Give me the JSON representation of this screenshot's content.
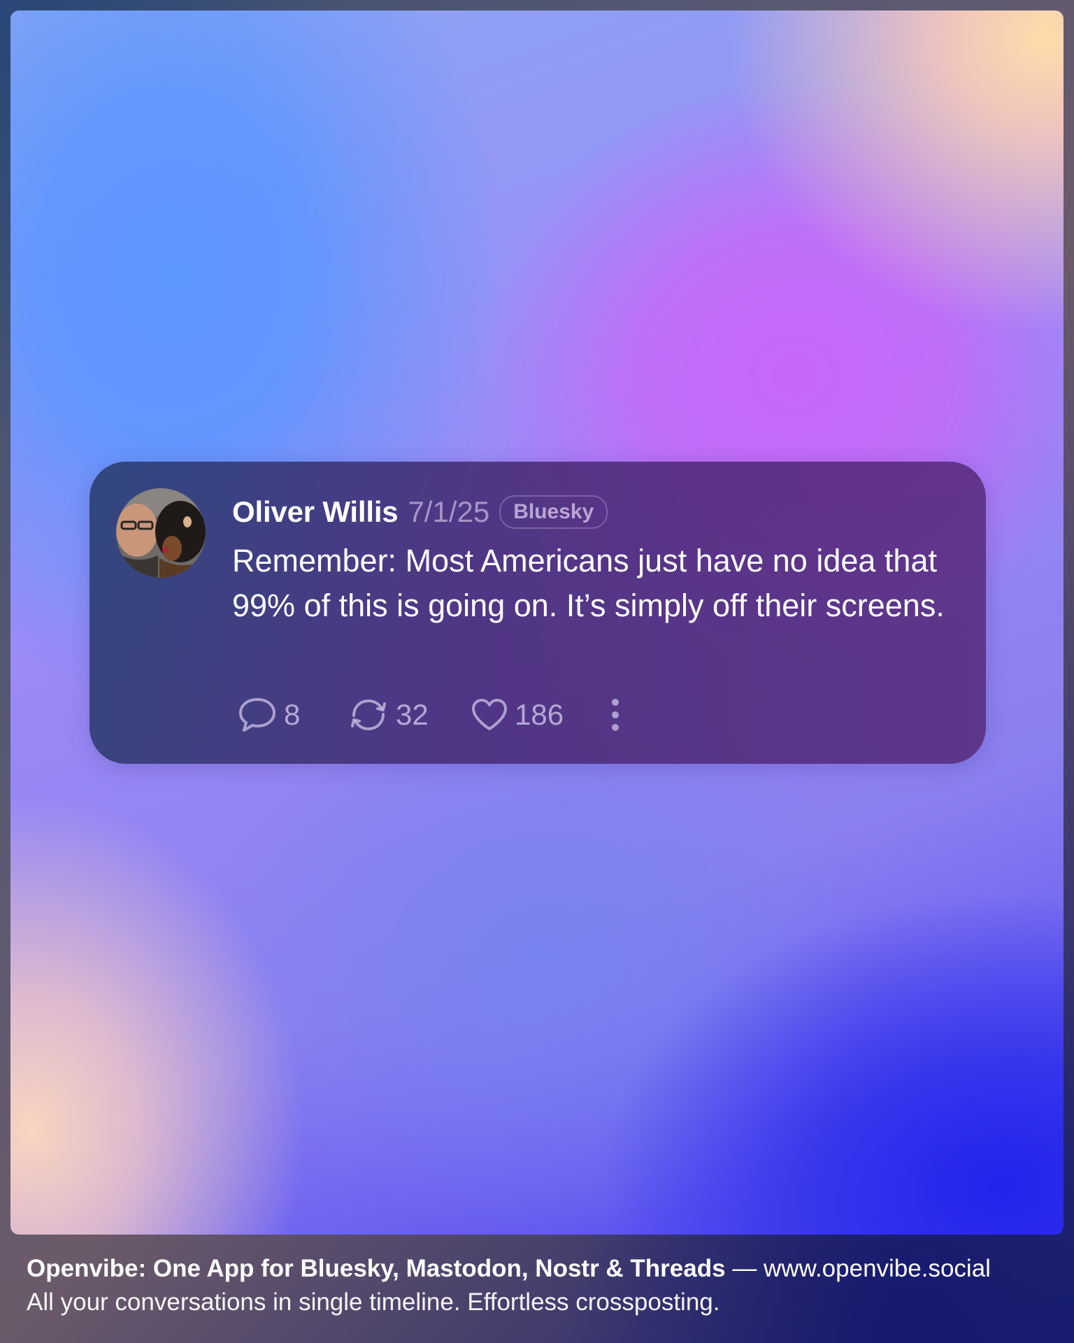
{
  "post": {
    "author": "Oliver Willis",
    "date": "7/1/25",
    "network": "Bluesky",
    "text": "Remember: Most Americans just have no idea that 99% of this is going on. It’s simply off their screens.",
    "actions": {
      "replies": "8",
      "reposts": "32",
      "likes": "186"
    },
    "icons": {
      "reply": "speech-bubble-icon",
      "repost": "repost-arrows-icon",
      "like": "heart-icon",
      "more": "more-vertical-icon"
    }
  },
  "footer": {
    "title": "Openvibe: One App for Bluesky, Mastodon, Nostr & Threads",
    "separator": "—",
    "url": "www.openvibe.social",
    "tagline": "All your conversations in single timeline. Effortless crossposting."
  },
  "colors": {
    "card_background": "#3f2c6e",
    "text_primary": "#ffffff",
    "text_muted": "#c8b9e1"
  }
}
